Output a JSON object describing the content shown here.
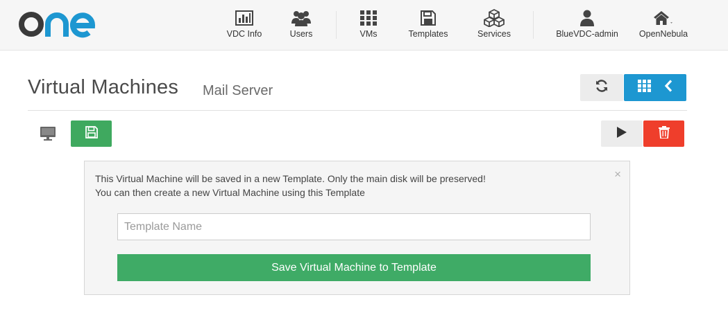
{
  "brand": {
    "logo_text": "one",
    "logo_colors": {
      "o": "#3a3a3a",
      "ne": "#1d97d1"
    }
  },
  "nav": {
    "items": [
      {
        "label": "VDC Info",
        "icon": "bar-chart-icon"
      },
      {
        "label": "Users",
        "icon": "users-icon"
      },
      {
        "label": "VMs",
        "icon": "grid-icon"
      },
      {
        "label": "Templates",
        "icon": "floppy-disk-icon"
      },
      {
        "label": "Services",
        "icon": "cubes-icon"
      },
      {
        "label": "BlueVDC-admin",
        "icon": "user-icon"
      },
      {
        "label": "OpenNebula",
        "icon": "home-icon"
      }
    ]
  },
  "header": {
    "title": "Virtual Machines",
    "subtitle": "Mail Server"
  },
  "toolbar": {
    "refresh_icon": "refresh-icon",
    "grid_icon": "grid-icon",
    "back_icon": "chevron-left-icon",
    "vnc_icon": "desktop-icon",
    "save_icon": "floppy-disk-icon",
    "play_icon": "play-icon",
    "delete_icon": "trash-icon"
  },
  "panel": {
    "message_line1": "This Virtual Machine will be saved in a new Template. Only the main disk will be preserved!",
    "message_line2": "You can then create a new Virtual Machine using this Template",
    "close_label": "×",
    "input": {
      "placeholder": "Template Name",
      "value": ""
    },
    "submit_label": "Save Virtual Machine to Template"
  },
  "colors": {
    "accent_blue": "#1d97d1",
    "success_green": "#3fa95f",
    "danger_red": "#ef3e2b",
    "topbar_bg": "#f6f6f6"
  }
}
